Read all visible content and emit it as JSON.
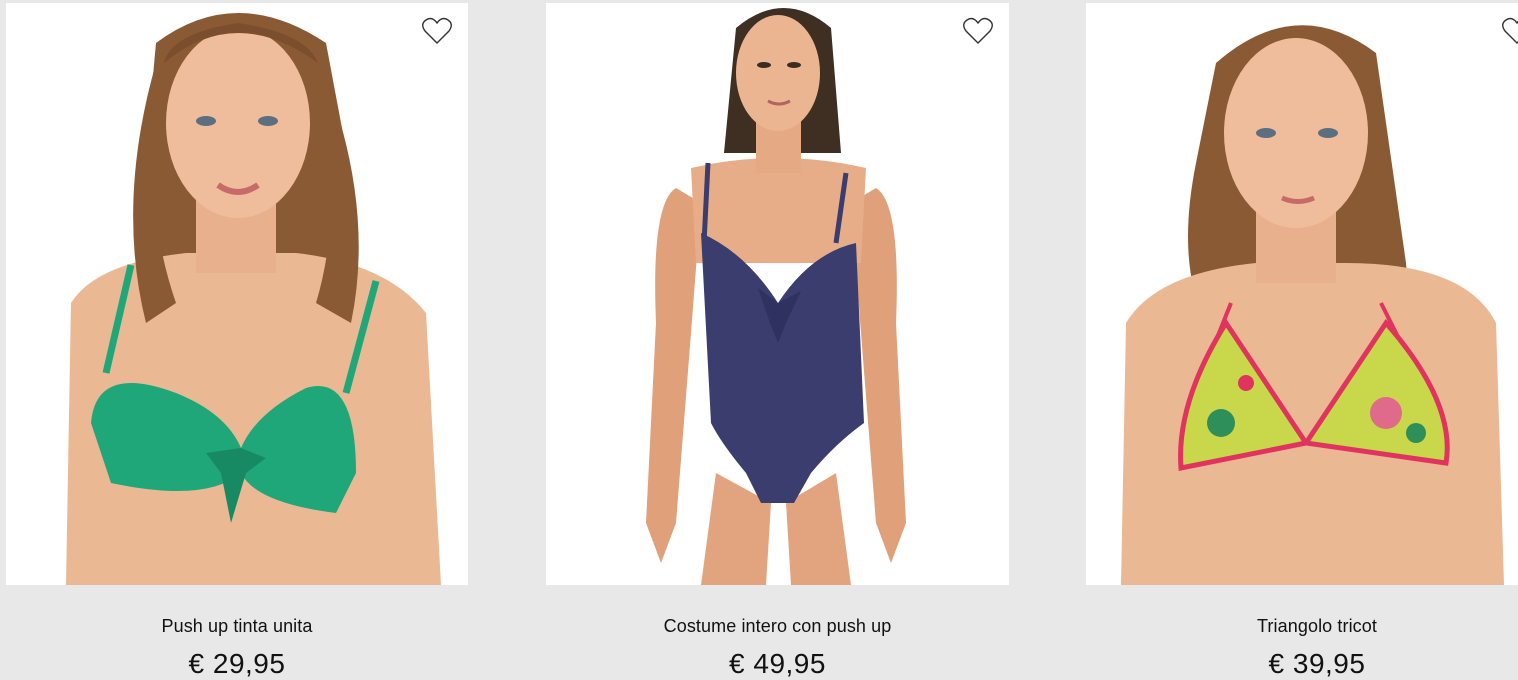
{
  "products": [
    {
      "name": "Push up tinta unita",
      "price": "€ 29,95",
      "swimwear_color": "#1fa77a"
    },
    {
      "name": "Costume intero con push up",
      "price": "€ 49,95",
      "swimwear_color": "#3b3d6e"
    },
    {
      "name": "Triangolo tricot",
      "price": "€ 39,95",
      "swimwear_color": "#c9d84a"
    }
  ],
  "icons": {
    "wishlist": "heart-outline-icon"
  },
  "colors": {
    "page_bg": "#e8e8e8",
    "card_bg": "#ffffff",
    "text": "#111111",
    "skin": "#e9b08e",
    "hair": "#8a5a34"
  }
}
